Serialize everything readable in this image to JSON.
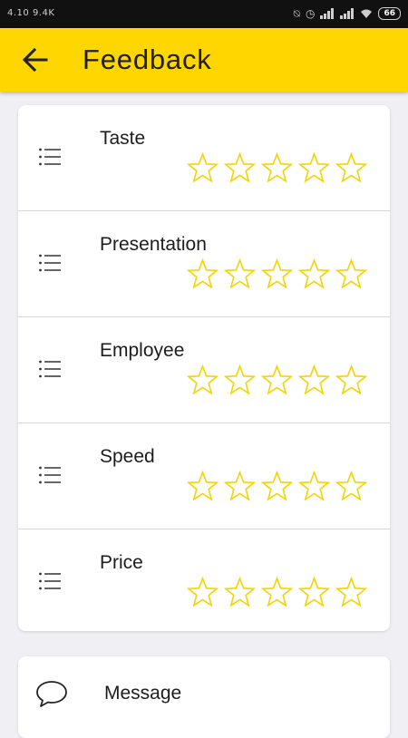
{
  "status_bar": {
    "left_text": "4.10 9.4K",
    "battery": "66",
    "icons": [
      "alarm-off-icon",
      "alarm-clock-icon",
      "signal-icon",
      "signal-icon",
      "wifi-icon",
      "battery-icon"
    ]
  },
  "header": {
    "title": "Feedback",
    "back_icon": "arrow-left-icon",
    "background": "#ffd600"
  },
  "ratings": [
    {
      "label": "Taste",
      "rating": 0,
      "max": 5
    },
    {
      "label": "Presentation",
      "rating": 0,
      "max": 5
    },
    {
      "label": "Employee",
      "rating": 0,
      "max": 5
    },
    {
      "label": "Speed",
      "rating": 0,
      "max": 5
    },
    {
      "label": "Price",
      "rating": 0,
      "max": 5
    }
  ],
  "star_color": "#f5d300",
  "message": {
    "label": "Message",
    "icon": "chat-bubble-icon"
  }
}
